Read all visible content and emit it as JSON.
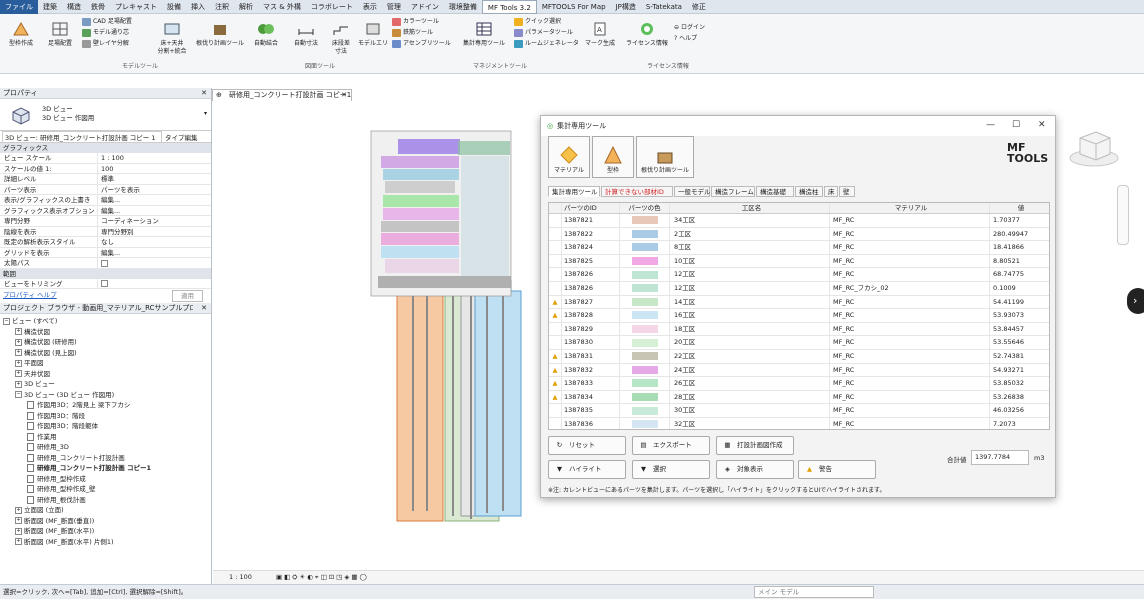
{
  "tabs": [
    "ファイル",
    "建築",
    "構造",
    "鉄骨",
    "プレキャスト",
    "設備",
    "挿入",
    "注釈",
    "解析",
    "マス & 外構",
    "コラボレート",
    "表示",
    "管理",
    "アドイン",
    "環境整備",
    "MF Tools 3.2",
    "MFTOOLS For Map",
    "JP構造",
    "S-Tatekata",
    "修正"
  ],
  "ribbon": {
    "big": [
      "型枠作成",
      "足場配置",
      "床+天井\n分割+統合",
      "根伐り計画ツール",
      "自動結合",
      "自動寸法",
      "床段差\n寸法",
      "モデルエリ",
      "集計専用ツール",
      "マーク生成",
      "ライセンス情報"
    ],
    "small1": [
      "CAD 足場配置",
      "モデル通り芯",
      "壁レイヤ分解"
    ],
    "small2": [
      "カラーツール",
      "鉄筋ツール",
      "アセンブリツール"
    ],
    "small3": [
      "クイック選択",
      "パラメータツール",
      "ルームジェネレータ"
    ],
    "small4": [
      "ログイン",
      "ヘルプ"
    ],
    "groups": [
      "モデルツール",
      "図面ツール",
      "マネジメントツール",
      "ライセンス情報"
    ]
  },
  "view_tab": "研修用_コンクリート打設計画 コピー1",
  "properties": {
    "title": "プロパティ",
    "type_name": "3D ビュー",
    "type_sub": "3D ビュー 作図用",
    "selector": "3D ビュー: 研修用_コンクリート打設計画 コピー 1",
    "edit_type": "タイプ編集",
    "section_graphics": "グラフィックス",
    "rows": [
      [
        "ビュー スケール",
        "1 : 100"
      ],
      [
        "スケールの値   1:",
        "100"
      ],
      [
        "詳細レベル",
        "標準"
      ],
      [
        "パーツ表示",
        "パーツを表示"
      ],
      [
        "表示/グラフィックスの上書き",
        "編集..."
      ],
      [
        "グラフィックス表示オプション",
        "編集..."
      ],
      [
        "専門分野",
        "コーディネーション"
      ],
      [
        "陰線を表示",
        "専門分野別"
      ],
      [
        "既定の解析表示スタイル",
        "なし"
      ],
      [
        "グリッドを表示",
        "編集..."
      ],
      [
        "太陽パス",
        ""
      ]
    ],
    "section_range": "範囲",
    "rows2": [
      [
        "ビューをトリミング",
        ""
      ]
    ],
    "help": "プロパティ ヘルプ",
    "apply": "適用"
  },
  "browser": {
    "title": "プロジェクト ブラウザ - 動画用_マテリアル_RCサンプルプロジェクト_新...",
    "items": [
      "ビュー (すべて)",
      "構造伏図",
      "構造伏図 (研修用)",
      "構造伏図 (見上図)",
      "平面図",
      "天井伏図",
      "3D ビュー",
      "3D ビュー (3D ビュー 作図用)",
      "作図用3D：2階見上 梁下フカシ",
      "作図用3D：階段",
      "作図用3D：階段躯体",
      "作業用",
      "研修用_3D",
      "研修用_コンクリート打設計画",
      "研修用_コンクリート打設計画 コピー1",
      "研修用_型枠作成",
      "研修用_型枠作成_壁",
      "研修用_根伐計画",
      "立面図 (立面)",
      "断面図 (MF_断面(垂直))",
      "断面図 (MF_断面(水平))",
      "断面図 (MF_断面(水平) 片側1)"
    ]
  },
  "dialog": {
    "title": "集計専用ツール",
    "tools": [
      "マテリアル",
      "型枠",
      "根伐り計画ツール"
    ],
    "logo1": "MF",
    "logo2": "TOOLS",
    "filter_tabs": [
      "集計専用ツール",
      "計算できない部材ID",
      "一般モデル",
      "構造フレーム",
      "構造基礎",
      "構造柱",
      "床",
      "壁"
    ],
    "headers": [
      "パーツのID",
      "パーツの色",
      "工区名",
      "マテリアル",
      "値"
    ],
    "rows": [
      {
        "w": false,
        "id": "1387821",
        "color": "#e8c9b8",
        "zone": "34工区",
        "mat": "MF_RC",
        "val": "1.70377"
      },
      {
        "w": false,
        "id": "1387822",
        "color": "#a9cbe6",
        "zone": "2工区",
        "mat": "MF_RC",
        "val": "280.49947"
      },
      {
        "w": false,
        "id": "1387824",
        "color": "#a9cbe6",
        "zone": "8工区",
        "mat": "MF_RC",
        "val": "18.41866"
      },
      {
        "w": false,
        "id": "1387825",
        "color": "#f3a8e6",
        "zone": "10工区",
        "mat": "MF_RC",
        "val": "8.80521"
      },
      {
        "w": false,
        "id": "1387826",
        "color": "#bfe6d5",
        "zone": "12工区",
        "mat": "MF_RC",
        "val": "68.74775"
      },
      {
        "w": false,
        "id": "1387826",
        "color": "#bfe6d5",
        "zone": "12工区",
        "mat": "MF_RC_フカシ_02",
        "val": "0.1009"
      },
      {
        "w": true,
        "id": "1387827",
        "color": "#c8e7c8",
        "zone": "14工区",
        "mat": "MF_RC",
        "val": "54.41199"
      },
      {
        "w": true,
        "id": "1387828",
        "color": "#cce5f3",
        "zone": "16工区",
        "mat": "MF_RC",
        "val": "53.93073"
      },
      {
        "w": false,
        "id": "1387829",
        "color": "#f5d6e6",
        "zone": "18工区",
        "mat": "MF_RC",
        "val": "53.84457"
      },
      {
        "w": false,
        "id": "1387830",
        "color": "#d5f0d5",
        "zone": "20工区",
        "mat": "MF_RC",
        "val": "53.55646"
      },
      {
        "w": true,
        "id": "1387831",
        "color": "#c9c5b5",
        "zone": "22工区",
        "mat": "MF_RC",
        "val": "52.74381"
      },
      {
        "w": true,
        "id": "1387832",
        "color": "#e6a8e6",
        "zone": "24工区",
        "mat": "MF_RC",
        "val": "54.93271"
      },
      {
        "w": true,
        "id": "1387833",
        "color": "#b5e6c5",
        "zone": "26工区",
        "mat": "MF_RC",
        "val": "53.85032"
      },
      {
        "w": true,
        "id": "1387834",
        "color": "#a8dcb5",
        "zone": "28工区",
        "mat": "MF_RC",
        "val": "53.26838"
      },
      {
        "w": false,
        "id": "1387835",
        "color": "#c8ebd9",
        "zone": "30工区",
        "mat": "MF_RC",
        "val": "46.03256"
      },
      {
        "w": false,
        "id": "1387836",
        "color": "#d5e6f3",
        "zone": "32工区",
        "mat": "MF_RC",
        "val": "7.2073"
      }
    ],
    "buttons": [
      "リセット",
      "エクスポート",
      "打設計画図作成",
      "ハイライト",
      "選択",
      "対象表示",
      "警告"
    ],
    "total_label": "合計値",
    "total_value": "1397.7784",
    "unit": "m3",
    "note": "※注: カレントビューにあるパーツを集計します。パーツを選択し「ハイライト」をクリックするとUIでハイライトされます。"
  },
  "viewbar": {
    "scale": "1 : 100"
  },
  "status": {
    "text": "選択=クリック, 次へ=[Tab], 追加=[Ctrl], 選択解除=[Shift]。",
    "model": "メイン モデル"
  }
}
